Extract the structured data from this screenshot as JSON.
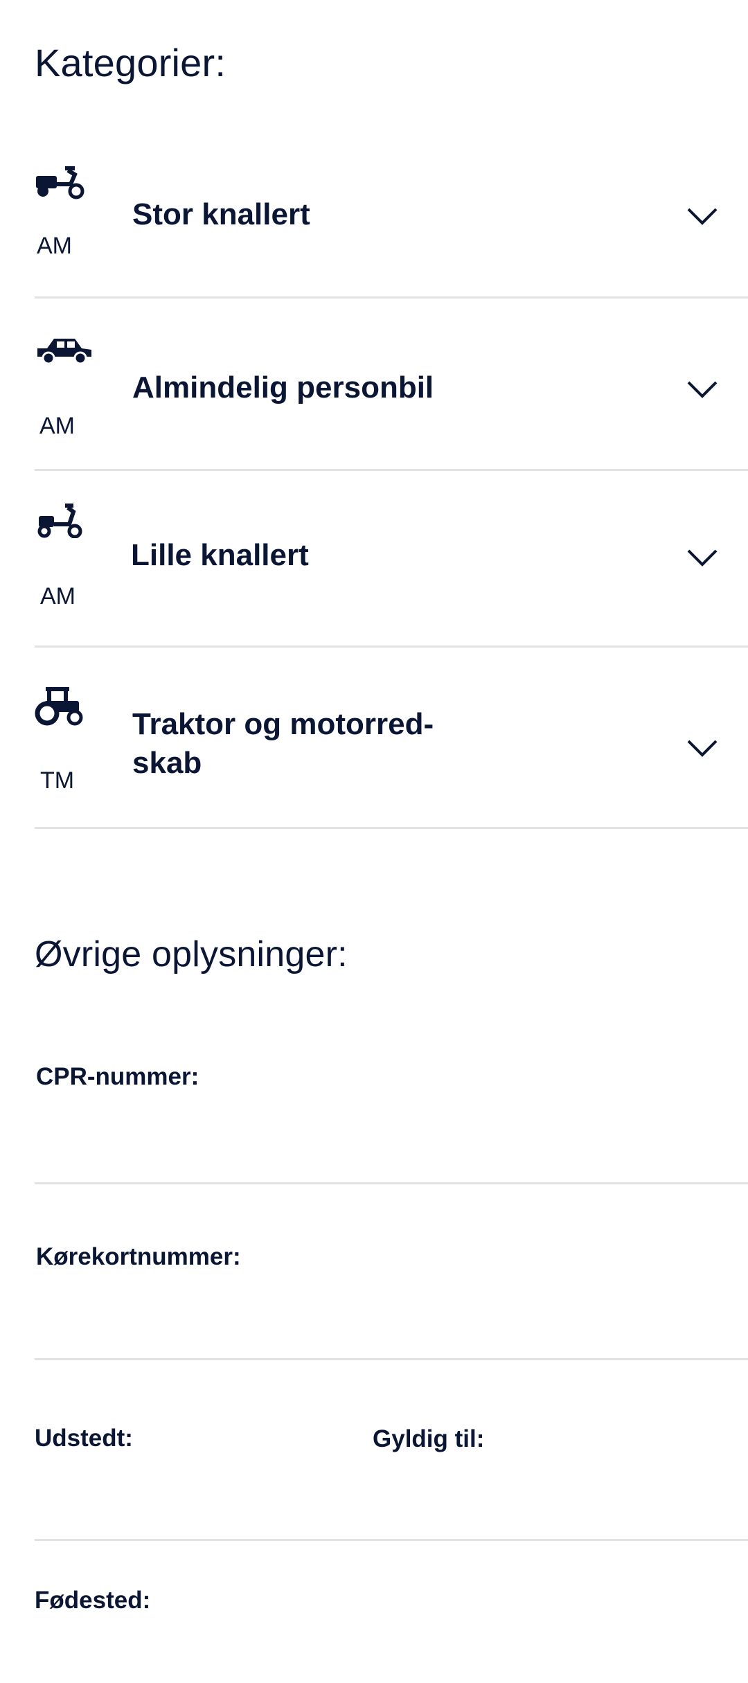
{
  "sections": {
    "categories_title": "Kategorier:",
    "other_title": "Øvrige oplysninger:"
  },
  "categories": [
    {
      "icon": "moped-large-icon",
      "code": "AM",
      "label": "Stor knallert"
    },
    {
      "icon": "car-icon",
      "code": "AM",
      "label": "Almindelig personbil"
    },
    {
      "icon": "moped-small-icon",
      "code": "AM",
      "label": "Lille knallert"
    },
    {
      "icon": "tractor-icon",
      "code": "TM",
      "label": "Traktor og motorred-\nskab"
    }
  ],
  "fields": {
    "cpr_label": "CPR-nummer:",
    "license_label": "Kørekortnummer:",
    "issued_label": "Udstedt:",
    "valid_label": "Gyldig til:",
    "birthplace_label": "Fødested:"
  },
  "colors": {
    "text": "#0a1633",
    "divider": "#e2e2e2",
    "background": "#ffffff"
  }
}
